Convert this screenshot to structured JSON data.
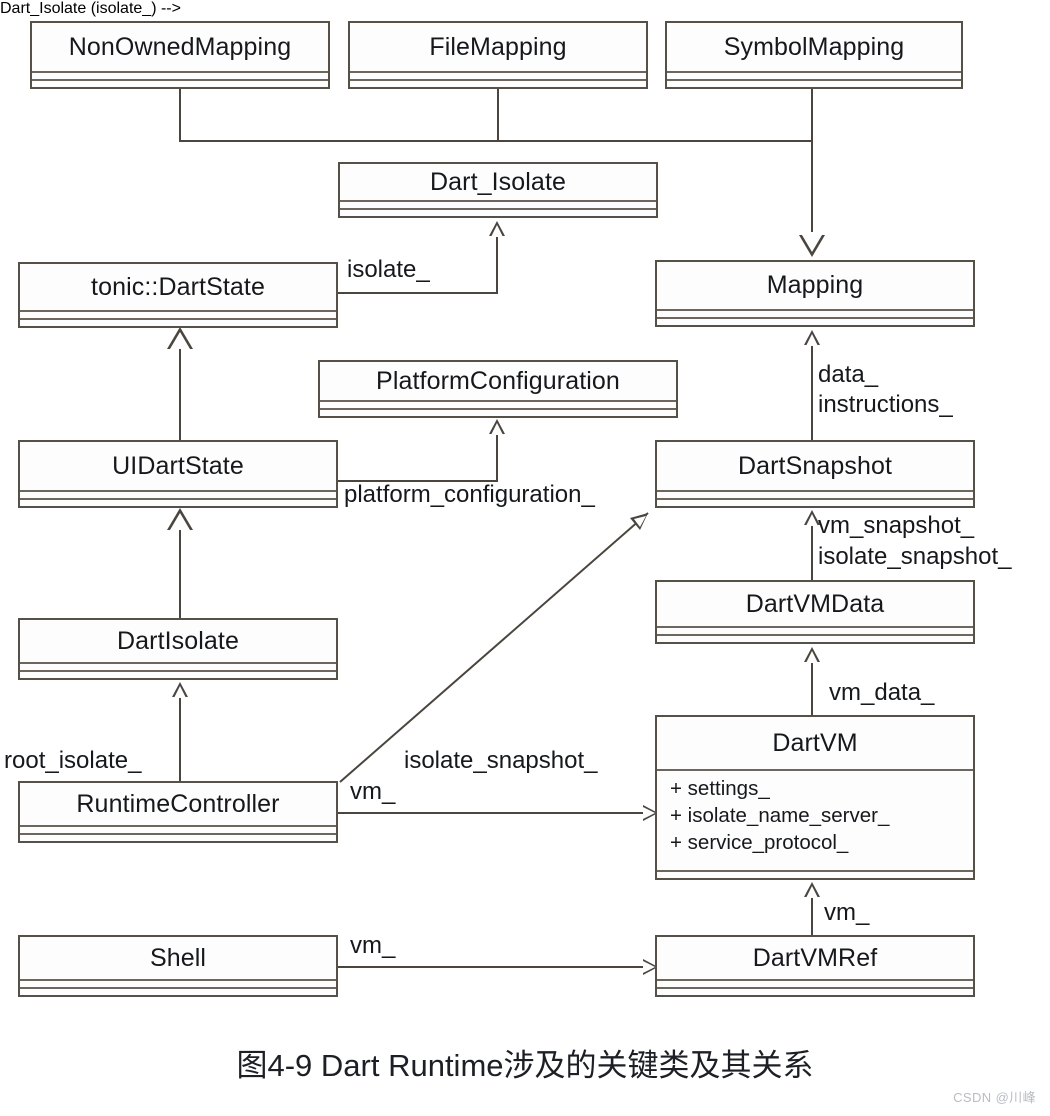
{
  "diagram": {
    "kind": "uml-class-diagram",
    "caption": "图4-9 Dart Runtime涉及的关键类及其关系",
    "watermark": "CSDN @川峰",
    "classes": [
      {
        "id": "non_owned_mapping",
        "name": "NonOwnedMapping",
        "attributes": []
      },
      {
        "id": "file_mapping",
        "name": "FileMapping",
        "attributes": []
      },
      {
        "id": "symbol_mapping",
        "name": "SymbolMapping",
        "attributes": []
      },
      {
        "id": "dart_isolate_c",
        "name": "Dart_Isolate",
        "attributes": []
      },
      {
        "id": "tonic_dartstate",
        "name": "tonic::DartState",
        "attributes": []
      },
      {
        "id": "mapping",
        "name": "Mapping",
        "attributes": []
      },
      {
        "id": "platform_config",
        "name": "PlatformConfiguration",
        "attributes": []
      },
      {
        "id": "ui_dart_state",
        "name": "UIDartState",
        "attributes": []
      },
      {
        "id": "dart_snapshot",
        "name": "DartSnapshot",
        "attributes": []
      },
      {
        "id": "dart_isolate",
        "name": "DartIsolate",
        "attributes": []
      },
      {
        "id": "dart_vm_data",
        "name": "DartVMData",
        "attributes": []
      },
      {
        "id": "runtime_controller",
        "name": "RuntimeController",
        "attributes": []
      },
      {
        "id": "dart_vm",
        "name": "DartVM",
        "attributes": [
          "+ settings_",
          "+ isolate_name_server_",
          "+ service_protocol_"
        ]
      },
      {
        "id": "shell",
        "name": "Shell",
        "attributes": []
      },
      {
        "id": "dart_vm_ref",
        "name": "DartVMRef",
        "attributes": []
      }
    ],
    "edge_labels": {
      "isolate": "isolate_",
      "platform_configuration": "platform_configuration_",
      "data": "data_",
      "instructions": "instructions_",
      "vm_snapshot": "vm_snapshot_",
      "isolate_snapshot_right": "isolate_snapshot_",
      "vm_data": "vm_data_",
      "root_isolate": "root_isolate_",
      "isolate_snapshot_diag": "isolate_snapshot_",
      "vm_runtime_controller": "vm_",
      "vm_dart_vm_ref": "vm_",
      "vm_shell": "vm_"
    },
    "colors": {
      "line": "#4a453e",
      "box_border": "#555048",
      "box_fill": "#fdfdfd",
      "text": "#16181c",
      "caption": "#1c1f25",
      "watermark": "#b9bcc2",
      "background": "#ffffff"
    }
  }
}
